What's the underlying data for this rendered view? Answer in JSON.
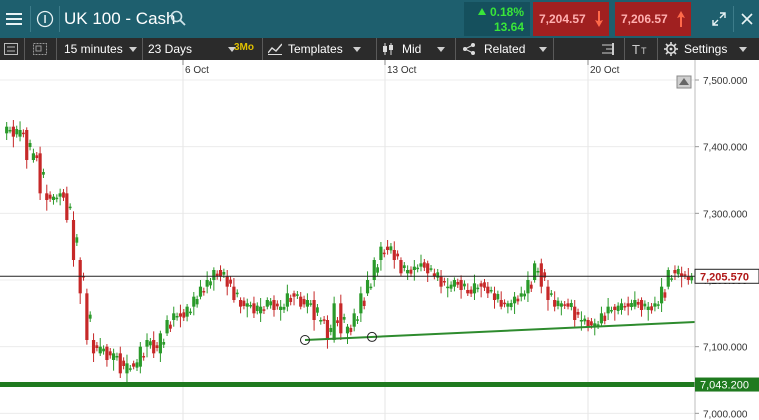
{
  "header": {
    "title": "UK 100 - Cash",
    "change_pct": "0.18%",
    "change_abs": "13.64",
    "sell_price": "7,204.57",
    "buy_price": "7,206.57",
    "colors": {
      "bar": "#1e5f6e",
      "sell": "#a02020",
      "buy": "#a02020",
      "change": "#39e639"
    }
  },
  "toolbar": {
    "interval": "15 minutes",
    "range": "23 Days",
    "range_badge": "3Mo",
    "templates": "Templates",
    "price_type": "Mid",
    "related": "Related",
    "settings": "Settings"
  },
  "chart_data": {
    "type": "candlestick",
    "x_ticks": [
      "6 Oct",
      "13 Oct",
      "20 Oct"
    ],
    "y_ticks": [
      "7,500.000",
      "7,400.000",
      "7,300.000",
      "7,200.000",
      "7,100.000",
      "7,000.000"
    ],
    "ylim": [
      6990,
      7530
    ],
    "current_price_label": "7,205.570",
    "current_price": 7205.57,
    "support_label": "7,043.200",
    "support_price": 7043.2,
    "trendline": {
      "from_price": 7110,
      "to_price": 7137
    },
    "series": [
      7420,
      7430,
      7415,
      7425,
      7380,
      7390,
      7330,
      7320,
      7325,
      7330,
      7290,
      7230,
      7180,
      7110,
      7090,
      7100,
      7080,
      7090,
      7060,
      7075,
      7070,
      7100,
      7110,
      7090,
      7120,
      7140,
      7150,
      7145,
      7160,
      7175,
      7190,
      7200,
      7215,
      7205,
      7190,
      7170,
      7160,
      7165,
      7150,
      7160,
      7170,
      7155,
      7160,
      7180,
      7175,
      7160,
      7170,
      7140,
      7140,
      7110,
      7165,
      7120,
      7130,
      7150,
      7180,
      7200,
      7230,
      7250,
      7245,
      7230,
      7210,
      7215,
      7220,
      7225,
      7210,
      7205,
      7190,
      7190,
      7200,
      7185,
      7180,
      7195,
      7190,
      7180,
      7170,
      7160,
      7165,
      7175,
      7180,
      7200,
      7225,
      7190,
      7170,
      7160,
      7165,
      7160,
      7140,
      7140,
      7130,
      7135,
      7150,
      7160,
      7155,
      7165,
      7160,
      7170,
      7155,
      7160,
      7165,
      7190,
      7215,
      7210,
      7205,
      7200
    ]
  },
  "icons": [
    "menu-icon",
    "info-icon",
    "search-icon",
    "expand-icon",
    "close-icon",
    "settings-gear-icon",
    "text-size-icon",
    "scroll-to-end-icon"
  ]
}
